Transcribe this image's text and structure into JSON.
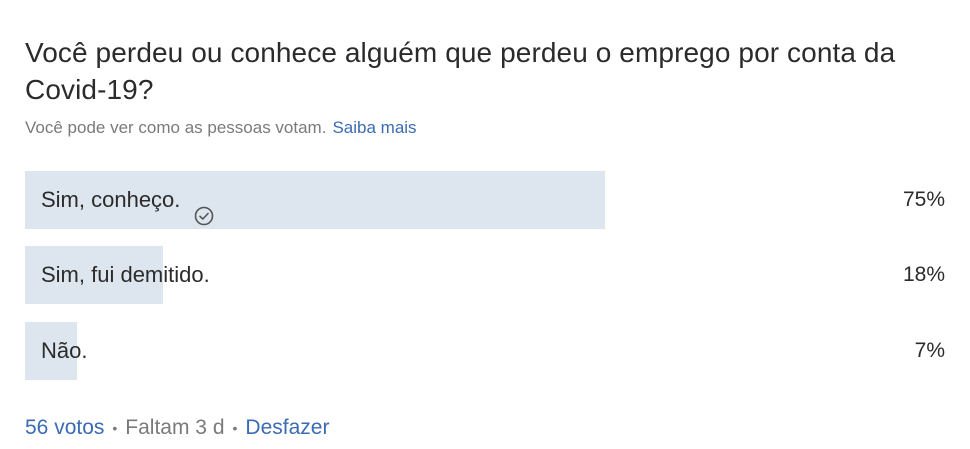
{
  "poll": {
    "question": "Você perdeu ou conhece alguém que perdeu o emprego por conta da Covid-19?",
    "subtitle": "Você pode ver como as pessoas votam.",
    "learn_more": "Saiba mais",
    "options": [
      {
        "label": "Sim, conheço.",
        "percent_text": "75%",
        "share": 0.63,
        "selected": true
      },
      {
        "label": "Sim, fui demitido.",
        "percent_text": "18%",
        "share": 0.15,
        "selected": false
      },
      {
        "label": "Não.",
        "percent_text": "7%",
        "share": 0.056,
        "selected": false
      }
    ],
    "footer": {
      "votes": "56 votos",
      "separator": "•",
      "remaining": "Faltam 3 d",
      "undo": "Desfazer"
    }
  },
  "colors": {
    "bar": "#dde6ee",
    "link": "#3b6bb3",
    "muted": "#7a7a7a"
  },
  "icons": {
    "selected": "check-circle-icon"
  }
}
